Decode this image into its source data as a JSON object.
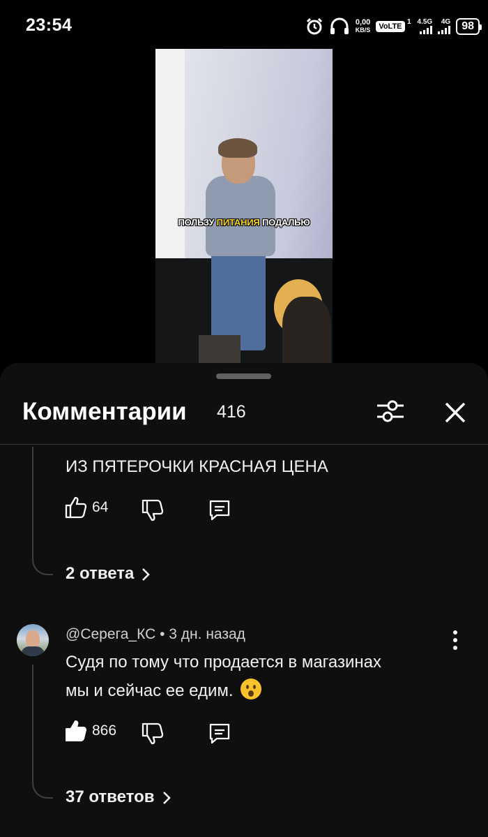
{
  "status_bar": {
    "time": "23:54",
    "net_speed_value": "0,00",
    "net_speed_unit": "KB/S",
    "volte": "VoLTE",
    "sim": "1",
    "signal1_label": "4.5G",
    "signal2_label": "4G",
    "battery": "98"
  },
  "video": {
    "caption_before": "ПОЛЬЗУ",
    "caption_highlight": "ПИТАНИЯ",
    "caption_after": "ПОДАЛЬЮ"
  },
  "comments": {
    "title": "Комментарии",
    "count": "416",
    "items": [
      {
        "text_line_2": "ИЗ ПЯТЕРОЧКИ КРАСНАЯ ЦЕНА",
        "likes": "64",
        "replies": "2 ответа"
      },
      {
        "author": "@Серега_КС",
        "time": "3 дн. назад",
        "text_line_1": "Судя по тому что продается в магазинах",
        "text_line_2": "мы и сейчас ее едим.",
        "likes": "866",
        "replies": "37 ответов"
      }
    ]
  },
  "icons": {
    "alarm": "alarm-icon",
    "headphones": "headphones-icon",
    "like": "thumb-up-icon",
    "dislike": "thumb-down-icon",
    "reply": "reply-icon",
    "filter": "filter-icon",
    "close": "close-icon",
    "more": "more-vert-icon",
    "emoji": "astonished-emoji-icon"
  }
}
